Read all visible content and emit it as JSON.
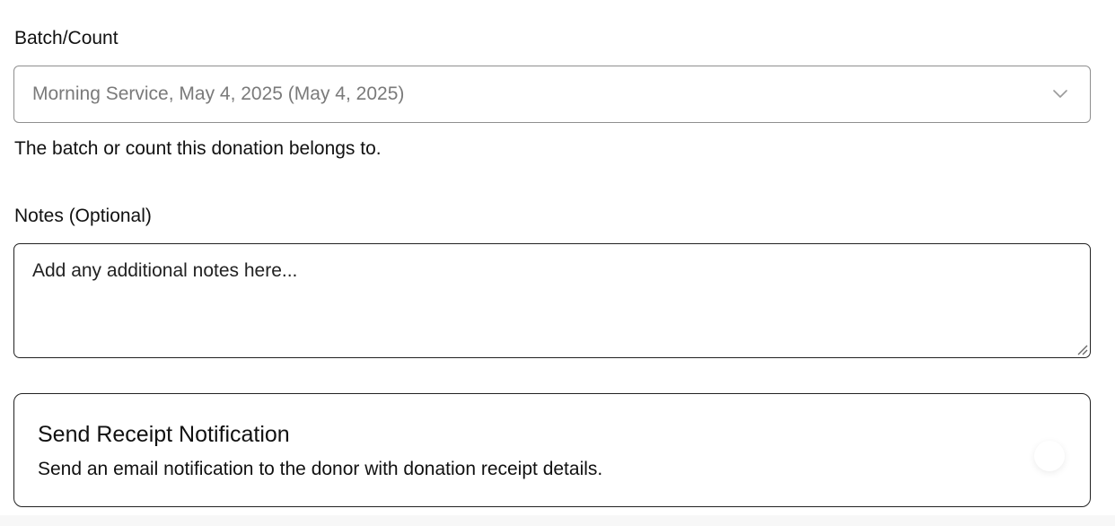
{
  "batch": {
    "label": "Batch/Count",
    "selected": "Morning Service, May 4, 2025 (May 4, 2025)",
    "help": "The batch or count this donation belongs to."
  },
  "notes": {
    "label": "Notes (Optional)",
    "placeholder": "Add any additional notes here..."
  },
  "receipt": {
    "title": "Send Receipt Notification",
    "description": "Send an email notification to the donor with donation receipt details.",
    "enabled": false
  },
  "icons": {
    "select_chevron": "chevron-down-icon",
    "resize_handle": "resize-handle-icon"
  },
  "colors": {
    "placeholder_text": "#7a7a7a",
    "border": "#222222"
  }
}
